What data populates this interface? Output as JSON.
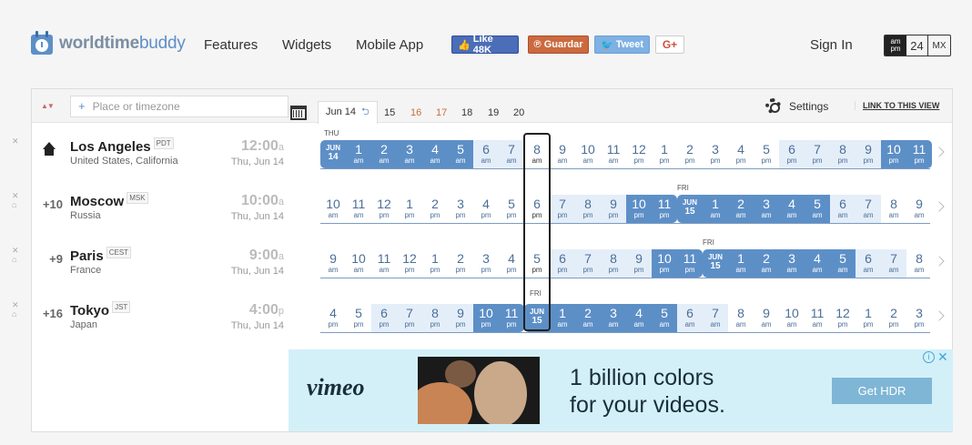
{
  "brand": {
    "a": "worldtime",
    "b": "buddy"
  },
  "nav": {
    "features": "Features",
    "widgets": "Widgets",
    "mobile": "Mobile App",
    "signin": "Sign In"
  },
  "social": {
    "like": "Like 48K",
    "save": "Guardar",
    "tweet": "Tweet",
    "gplus": "G+"
  },
  "fmt": {
    "ampm_top": "am",
    "ampm_bot": "pm",
    "h24": "24",
    "mx": "MX"
  },
  "toolbar": {
    "search_placeholder": "Place or timezone",
    "datetab": "Jun 14",
    "dates": [
      "15",
      "16",
      "17",
      "18",
      "19",
      "20"
    ],
    "settings": "Settings",
    "link": "LINK TO THIS VIEW"
  },
  "colors": {
    "accent": "#5d8fc7",
    "weekend": "#cb6a3f"
  },
  "rows": [
    {
      "offset": "",
      "city": "Los Angeles",
      "abbr": "PDT",
      "country": "United States, California",
      "time": "12:00",
      "ap": "a",
      "date": "Thu, Jun 14",
      "daylbl": "THU",
      "nl": "FRI",
      "cells": [
        {
          "n": "JUN",
          "s": "14",
          "t": "day"
        },
        {
          "n": "1",
          "s": "am",
          "t": "t3"
        },
        {
          "n": "2",
          "s": "am",
          "t": "t3"
        },
        {
          "n": "3",
          "s": "am",
          "t": "t3"
        },
        {
          "n": "4",
          "s": "am",
          "t": "t3"
        },
        {
          "n": "5",
          "s": "am",
          "t": "t3"
        },
        {
          "n": "6",
          "s": "am",
          "t": "t1"
        },
        {
          "n": "7",
          "s": "am",
          "t": "t1"
        },
        {
          "n": "8",
          "s": "am",
          "t": "mid"
        },
        {
          "n": "9",
          "s": "am",
          "t": "t0"
        },
        {
          "n": "10",
          "s": "am",
          "t": "t0"
        },
        {
          "n": "11",
          "s": "am",
          "t": "t0"
        },
        {
          "n": "12",
          "s": "pm",
          "t": "t0"
        },
        {
          "n": "1",
          "s": "pm",
          "t": "t0"
        },
        {
          "n": "2",
          "s": "pm",
          "t": "t0"
        },
        {
          "n": "3",
          "s": "pm",
          "t": "t0"
        },
        {
          "n": "4",
          "s": "pm",
          "t": "t0"
        },
        {
          "n": "5",
          "s": "pm",
          "t": "t0"
        },
        {
          "n": "6",
          "s": "pm",
          "t": "t1"
        },
        {
          "n": "7",
          "s": "pm",
          "t": "t1"
        },
        {
          "n": "8",
          "s": "pm",
          "t": "t1"
        },
        {
          "n": "9",
          "s": "pm",
          "t": "t1"
        },
        {
          "n": "10",
          "s": "pm",
          "t": "t3"
        },
        {
          "n": "11",
          "s": "pm",
          "t": "t3 end"
        }
      ]
    },
    {
      "offset": "+10",
      "city": "Moscow",
      "abbr": "MSK",
      "country": "Russia",
      "time": "10:00",
      "ap": "a",
      "date": "Thu, Jun 14",
      "daylbl": "FRI",
      "cells": [
        {
          "n": "10",
          "s": "am",
          "t": "t0"
        },
        {
          "n": "11",
          "s": "am",
          "t": "t0"
        },
        {
          "n": "12",
          "s": "pm",
          "t": "t0"
        },
        {
          "n": "1",
          "s": "pm",
          "t": "t0"
        },
        {
          "n": "2",
          "s": "pm",
          "t": "t0"
        },
        {
          "n": "3",
          "s": "pm",
          "t": "t0"
        },
        {
          "n": "4",
          "s": "pm",
          "t": "t0"
        },
        {
          "n": "5",
          "s": "pm",
          "t": "t0"
        },
        {
          "n": "6",
          "s": "pm",
          "t": "mid"
        },
        {
          "n": "7",
          "s": "pm",
          "t": "t1"
        },
        {
          "n": "8",
          "s": "pm",
          "t": "t1"
        },
        {
          "n": "9",
          "s": "pm",
          "t": "t1"
        },
        {
          "n": "10",
          "s": "pm",
          "t": "t3"
        },
        {
          "n": "11",
          "s": "pm",
          "t": "t3 end"
        },
        {
          "n": "JUN",
          "s": "15",
          "t": "day"
        },
        {
          "n": "1",
          "s": "am",
          "t": "t3"
        },
        {
          "n": "2",
          "s": "am",
          "t": "t3"
        },
        {
          "n": "3",
          "s": "am",
          "t": "t3"
        },
        {
          "n": "4",
          "s": "am",
          "t": "t3"
        },
        {
          "n": "5",
          "s": "am",
          "t": "t3"
        },
        {
          "n": "6",
          "s": "am",
          "t": "t1"
        },
        {
          "n": "7",
          "s": "am",
          "t": "t1"
        },
        {
          "n": "8",
          "s": "am",
          "t": "t0"
        },
        {
          "n": "9",
          "s": "am",
          "t": "t0"
        }
      ]
    },
    {
      "offset": "+9",
      "city": "Paris",
      "abbr": "CEST",
      "country": "France",
      "time": "9:00",
      "ap": "a",
      "date": "Thu, Jun 14",
      "daylbl": "FRI",
      "cells": [
        {
          "n": "9",
          "s": "am",
          "t": "t0"
        },
        {
          "n": "10",
          "s": "am",
          "t": "t0"
        },
        {
          "n": "11",
          "s": "am",
          "t": "t0"
        },
        {
          "n": "12",
          "s": "pm",
          "t": "t0"
        },
        {
          "n": "1",
          "s": "pm",
          "t": "t0"
        },
        {
          "n": "2",
          "s": "pm",
          "t": "t0"
        },
        {
          "n": "3",
          "s": "pm",
          "t": "t0"
        },
        {
          "n": "4",
          "s": "pm",
          "t": "t0"
        },
        {
          "n": "5",
          "s": "pm",
          "t": "mid"
        },
        {
          "n": "6",
          "s": "pm",
          "t": "t1"
        },
        {
          "n": "7",
          "s": "pm",
          "t": "t1"
        },
        {
          "n": "8",
          "s": "pm",
          "t": "t1"
        },
        {
          "n": "9",
          "s": "pm",
          "t": "t1"
        },
        {
          "n": "10",
          "s": "pm",
          "t": "t3"
        },
        {
          "n": "11",
          "s": "pm",
          "t": "t3 end"
        },
        {
          "n": "JUN",
          "s": "15",
          "t": "day"
        },
        {
          "n": "1",
          "s": "am",
          "t": "t3"
        },
        {
          "n": "2",
          "s": "am",
          "t": "t3"
        },
        {
          "n": "3",
          "s": "am",
          "t": "t3"
        },
        {
          "n": "4",
          "s": "am",
          "t": "t3"
        },
        {
          "n": "5",
          "s": "am",
          "t": "t3"
        },
        {
          "n": "6",
          "s": "am",
          "t": "t1"
        },
        {
          "n": "7",
          "s": "am",
          "t": "t1"
        },
        {
          "n": "8",
          "s": "am",
          "t": "t0"
        }
      ]
    },
    {
      "offset": "+16",
      "city": "Tokyo",
      "abbr": "JST",
      "country": "Japan",
      "time": "4:00",
      "ap": "p",
      "date": "Thu, Jun 14",
      "daylbl": "",
      "cells": [
        {
          "n": "4",
          "s": "pm",
          "t": "t0"
        },
        {
          "n": "5",
          "s": "pm",
          "t": "t0"
        },
        {
          "n": "6",
          "s": "pm",
          "t": "t1"
        },
        {
          "n": "7",
          "s": "pm",
          "t": "t1"
        },
        {
          "n": "8",
          "s": "pm",
          "t": "t1"
        },
        {
          "n": "9",
          "s": "pm",
          "t": "t1"
        },
        {
          "n": "10",
          "s": "pm",
          "t": "t3"
        },
        {
          "n": "11",
          "s": "pm",
          "t": "t3 end"
        },
        {
          "n": "JUN",
          "s": "15",
          "t": "day"
        },
        {
          "n": "1",
          "s": "am",
          "t": "t3"
        },
        {
          "n": "2",
          "s": "am",
          "t": "t3"
        },
        {
          "n": "3",
          "s": "am",
          "t": "t3"
        },
        {
          "n": "4",
          "s": "am",
          "t": "t3"
        },
        {
          "n": "5",
          "s": "am",
          "t": "t3"
        },
        {
          "n": "6",
          "s": "am",
          "t": "t1"
        },
        {
          "n": "7",
          "s": "am",
          "t": "t1"
        },
        {
          "n": "8",
          "s": "am",
          "t": "t0"
        },
        {
          "n": "9",
          "s": "am",
          "t": "t0"
        },
        {
          "n": "10",
          "s": "am",
          "t": "t0"
        },
        {
          "n": "11",
          "s": "am",
          "t": "t0"
        },
        {
          "n": "12",
          "s": "pm",
          "t": "t0"
        },
        {
          "n": "1",
          "s": "pm",
          "t": "t0"
        },
        {
          "n": "2",
          "s": "pm",
          "t": "t0"
        },
        {
          "n": "3",
          "s": "pm",
          "t": "t0"
        }
      ]
    }
  ],
  "ad": {
    "brand": "vimeo",
    "line1": "1 billion colors",
    "line2": "for your videos.",
    "button": "Get HDR",
    "info": "i",
    "close": "✕"
  }
}
